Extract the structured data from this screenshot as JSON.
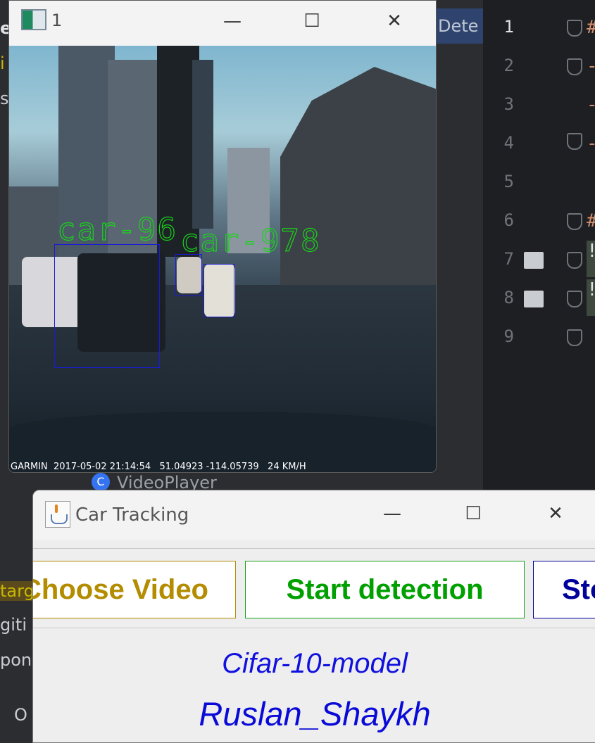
{
  "ide": {
    "tab_fragment": "Dete",
    "line_numbers": [
      "1",
      "2",
      "3",
      "4",
      "5",
      "6",
      "7",
      "8",
      "9"
    ],
    "left_fragments": [
      "e",
      "i",
      "s",
      "targ",
      "giti",
      "pon",
      "O"
    ],
    "code_fragments": [
      "#",
      "-",
      "-",
      "-",
      "#",
      "!",
      "!"
    ]
  },
  "video_window": {
    "title": "1",
    "minimize_glyph": "—",
    "maximize_glyph": "☐",
    "close_glyph": "✕",
    "detections": [
      {
        "label": "car-96"
      },
      {
        "label": "car-978"
      }
    ],
    "osd_text": "GARMIN  2017-05-02 21:14:54   51.04923 -114.05739   24 KM/H"
  },
  "background_item": {
    "icon_letter": "C",
    "label": "VideoPlayer"
  },
  "car_tracking_window": {
    "title": "Car Tracking",
    "minimize_glyph": "—",
    "maximize_glyph": "☐",
    "close_glyph": "✕",
    "buttons": {
      "choose_video": "Choose Video",
      "start_detection": "Start detection",
      "stop": "Stop"
    },
    "model_label": "Cifar-10-model",
    "author_label": "Ruslan_Shaykh",
    "colors": {
      "choose": "#b38c00",
      "start": "#00a000",
      "stop": "#00009c",
      "info": "#1010e0"
    }
  }
}
